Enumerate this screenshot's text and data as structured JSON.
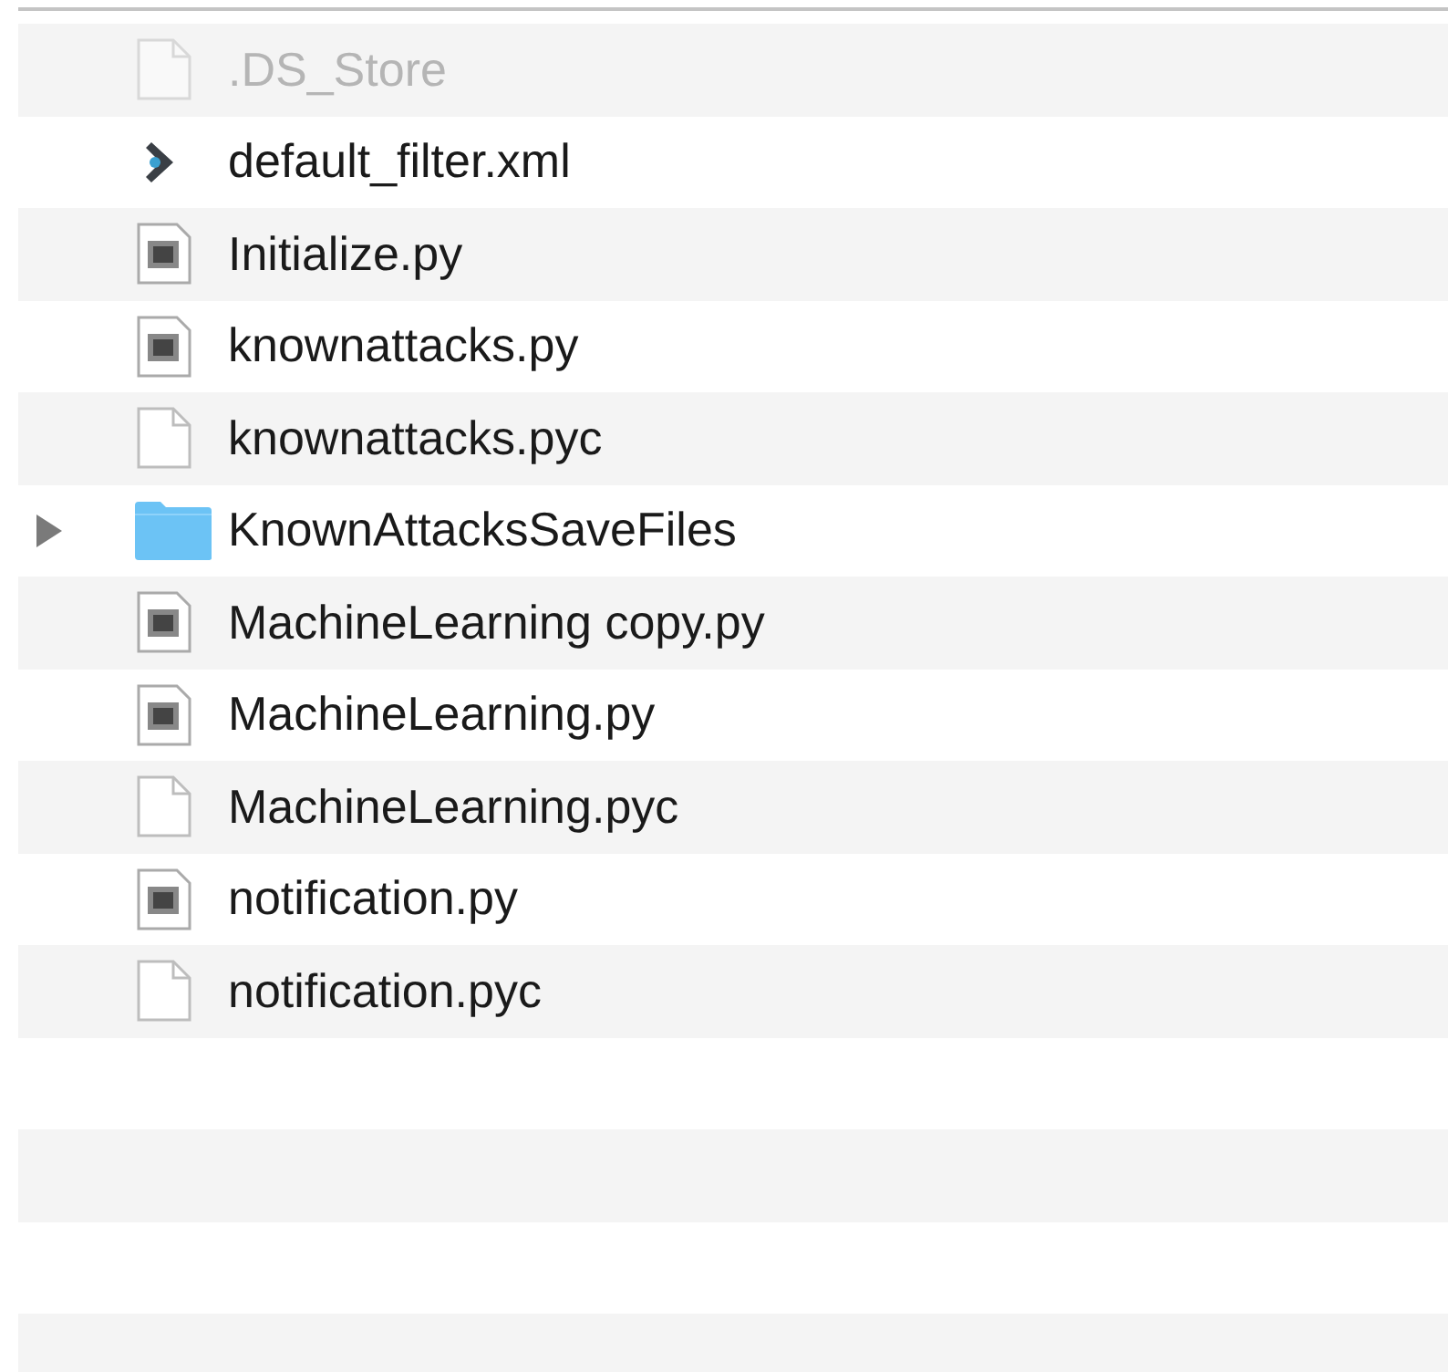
{
  "files": [
    {
      "name": ".DS_Store",
      "kind": "file",
      "hidden": true
    },
    {
      "name": "default_filter.xml",
      "kind": "xml",
      "hidden": false
    },
    {
      "name": "Initialize.py",
      "kind": "script",
      "hidden": false
    },
    {
      "name": "knownattacks.py",
      "kind": "script",
      "hidden": false
    },
    {
      "name": "knownattacks.pyc",
      "kind": "file",
      "hidden": false
    },
    {
      "name": "KnownAttacksSaveFiles",
      "kind": "folder",
      "hidden": false,
      "expanded": false
    },
    {
      "name": "MachineLearning copy.py",
      "kind": "script",
      "hidden": false
    },
    {
      "name": "MachineLearning.py",
      "kind": "script",
      "hidden": false
    },
    {
      "name": "MachineLearning.pyc",
      "kind": "file",
      "hidden": false
    },
    {
      "name": "notification.py",
      "kind": "script",
      "hidden": false
    },
    {
      "name": "notification.pyc",
      "kind": "file",
      "hidden": false
    }
  ]
}
